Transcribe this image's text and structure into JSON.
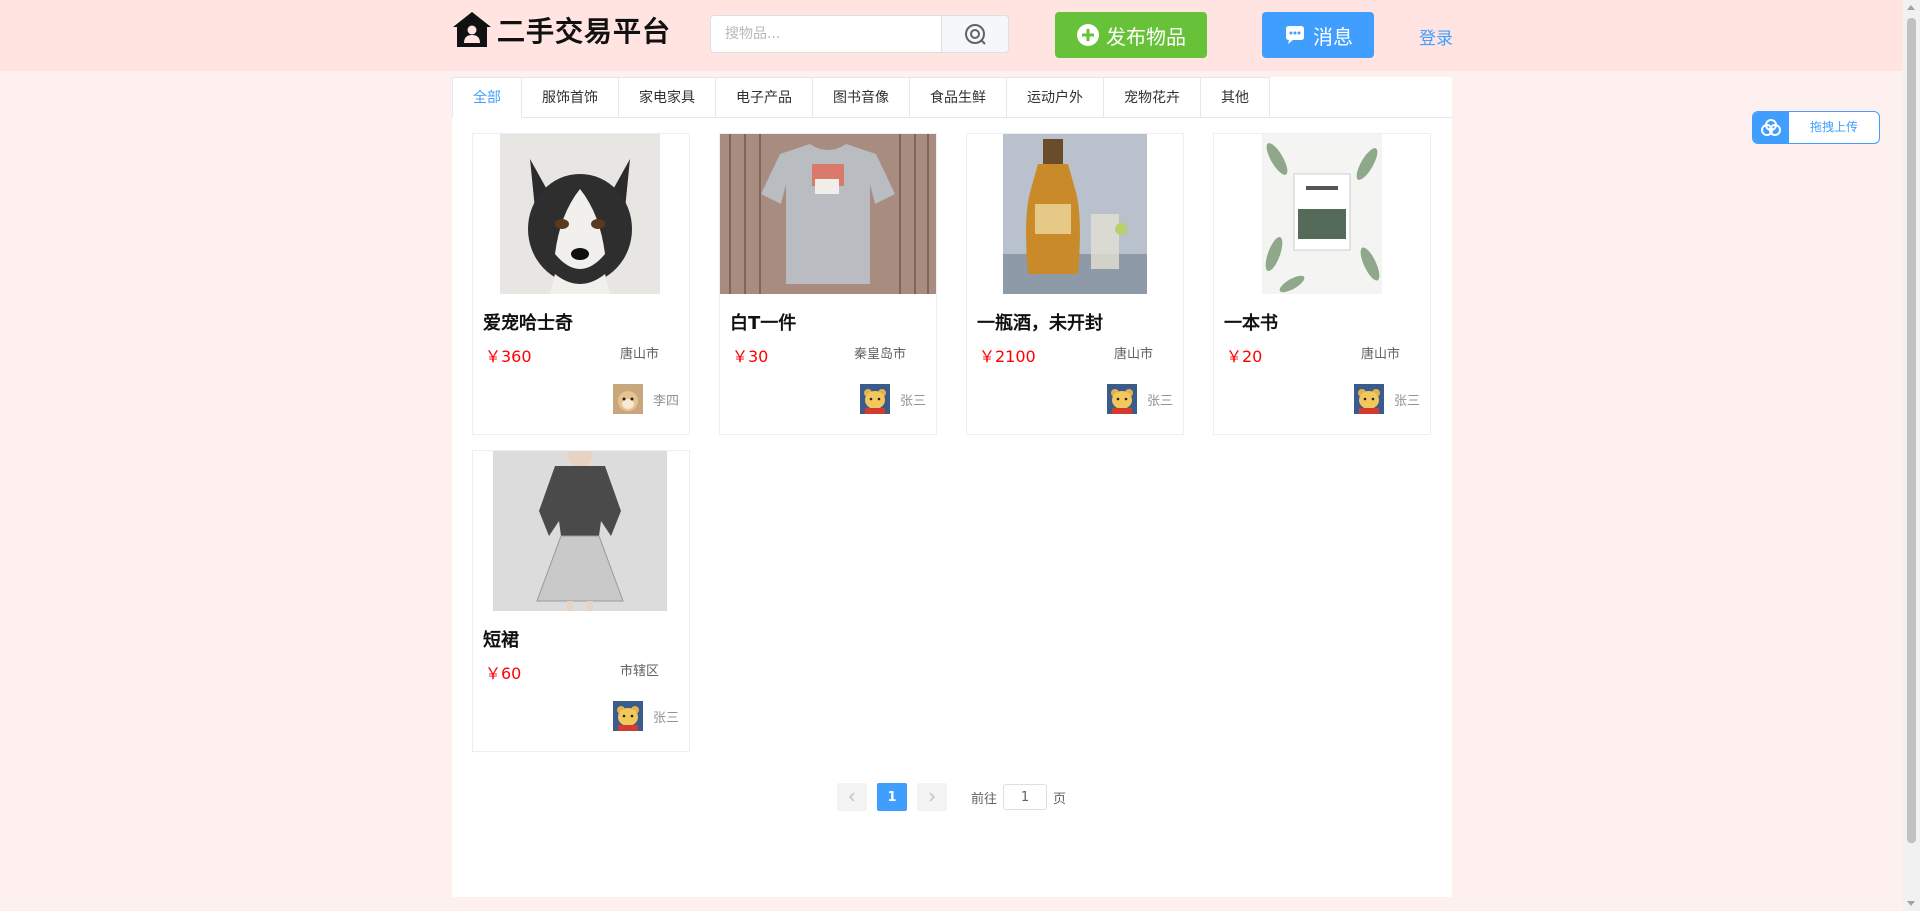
{
  "header": {
    "logo_text": "二手交易平台",
    "search_placeholder": "搜物品...",
    "publish_label": "发布物品",
    "message_label": "消息",
    "login_label": "登录"
  },
  "tabs": [
    "全部",
    "服饰首饰",
    "家电家具",
    "电子产品",
    "图书音像",
    "食品生鲜",
    "运动户外",
    "宠物花卉",
    "其他"
  ],
  "active_tab": "全部",
  "products": [
    {
      "title": "爱宠哈士奇",
      "price": "￥360",
      "city": "唐山市",
      "user": "李四"
    },
    {
      "title": "白T一件",
      "price": "￥30",
      "city": "秦皇岛市",
      "user": "张三"
    },
    {
      "title": "一瓶酒，未开封",
      "price": "￥2100",
      "city": "唐山市",
      "user": "张三"
    },
    {
      "title": "一本书",
      "price": "￥20",
      "city": "唐山市",
      "user": "张三"
    },
    {
      "title": "短裙",
      "price": "￥60",
      "city": "市辖区",
      "user": "张三"
    }
  ],
  "pagination": {
    "current_page": "1",
    "goto_prefix": "前往",
    "goto_value": "1",
    "goto_suffix": "页"
  },
  "upload_widget": {
    "label": "拖拽上传"
  },
  "colors": {
    "primary": "#409eff",
    "success": "#67c23a",
    "price": "#ff0000",
    "header_bg": "#ffe4e1",
    "page_bg": "#fff0f0"
  }
}
